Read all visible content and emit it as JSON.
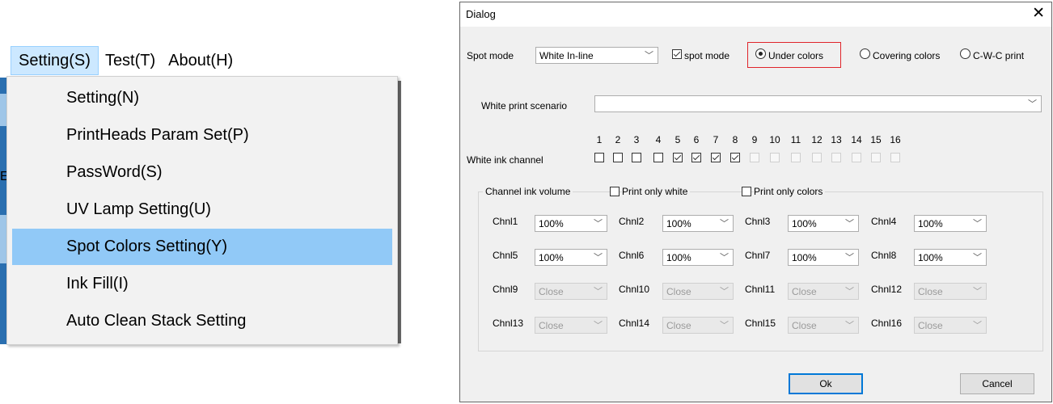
{
  "menubar": {
    "items": [
      {
        "label": "Setting(S)",
        "active": true
      },
      {
        "label": "Test(T)",
        "active": false
      },
      {
        "label": "About(H)",
        "active": false
      }
    ]
  },
  "dropdown": {
    "items": [
      {
        "label": "Setting(N)"
      },
      {
        "label": "PrintHeads Param Set(P)"
      },
      {
        "label": "PassWord(S)"
      },
      {
        "label": "UV Lamp Setting(U)"
      },
      {
        "label": "Spot Colors Setting(Y)",
        "highlighted": true
      },
      {
        "label": "Ink Fill(I)"
      },
      {
        "label": "Auto Clean Stack Setting"
      }
    ]
  },
  "background_fragment": "E",
  "dialog": {
    "title": "Dialog",
    "close_glyph": "✕",
    "spot_mode_label": "Spot mode",
    "spot_mode_value": "White In-line",
    "spot_mode_checkbox": {
      "label": "spot mode",
      "checked": true
    },
    "radios": [
      {
        "label": "Under colors",
        "checked": true,
        "highlighted": true
      },
      {
        "label": "Covering colors",
        "checked": false
      },
      {
        "label": "C-W-C print",
        "checked": false
      }
    ],
    "white_print_scenario_label": "White print scenario",
    "white_print_scenario_value": "",
    "white_ink_channel_label": "White ink channel",
    "channel_numbers": [
      "1",
      "2",
      "3",
      "4",
      "5",
      "6",
      "7",
      "8",
      "9",
      "10",
      "11",
      "12",
      "13",
      "14",
      "15",
      "16"
    ],
    "channel_checks": [
      false,
      false,
      false,
      false,
      true,
      true,
      true,
      true,
      false,
      false,
      false,
      false,
      false,
      false,
      false,
      false
    ],
    "channel_enabled": [
      true,
      true,
      true,
      true,
      true,
      true,
      true,
      true,
      false,
      false,
      false,
      false,
      false,
      false,
      false,
      false
    ],
    "ink_volume_group_label": "Channel ink volume",
    "print_only_white": {
      "label": "Print only white",
      "checked": false
    },
    "print_only_colors": {
      "label": "Print only colors",
      "checked": false
    },
    "channels": [
      {
        "label": "Chnl1",
        "value": "100%",
        "enabled": true
      },
      {
        "label": "Chnl2",
        "value": "100%",
        "enabled": true
      },
      {
        "label": "Chnl3",
        "value": "100%",
        "enabled": true
      },
      {
        "label": "Chnl4",
        "value": "100%",
        "enabled": true
      },
      {
        "label": "Chnl5",
        "value": "100%",
        "enabled": true
      },
      {
        "label": "Chnl6",
        "value": "100%",
        "enabled": true
      },
      {
        "label": "Chnl7",
        "value": "100%",
        "enabled": true
      },
      {
        "label": "Chnl8",
        "value": "100%",
        "enabled": true
      },
      {
        "label": "Chnl9",
        "value": "Close",
        "enabled": false
      },
      {
        "label": "Chnl10",
        "value": "Close",
        "enabled": false
      },
      {
        "label": "Chnl11",
        "value": "Close",
        "enabled": false
      },
      {
        "label": "Chnl12",
        "value": "Close",
        "enabled": false
      },
      {
        "label": "Chnl13",
        "value": "Close",
        "enabled": false
      },
      {
        "label": "Chnl14",
        "value": "Close",
        "enabled": false
      },
      {
        "label": "Chnl15",
        "value": "Close",
        "enabled": false
      },
      {
        "label": "Chnl16",
        "value": "Close",
        "enabled": false
      }
    ],
    "ok_label": "Ok",
    "cancel_label": "Cancel",
    "arrow_glyph": "﹀"
  },
  "colors": {
    "menu_highlight": "#91c9f7",
    "menubar_active": "#cce8ff",
    "radio_highlight_border": "#e0242a",
    "default_button_border": "#0078d7"
  }
}
